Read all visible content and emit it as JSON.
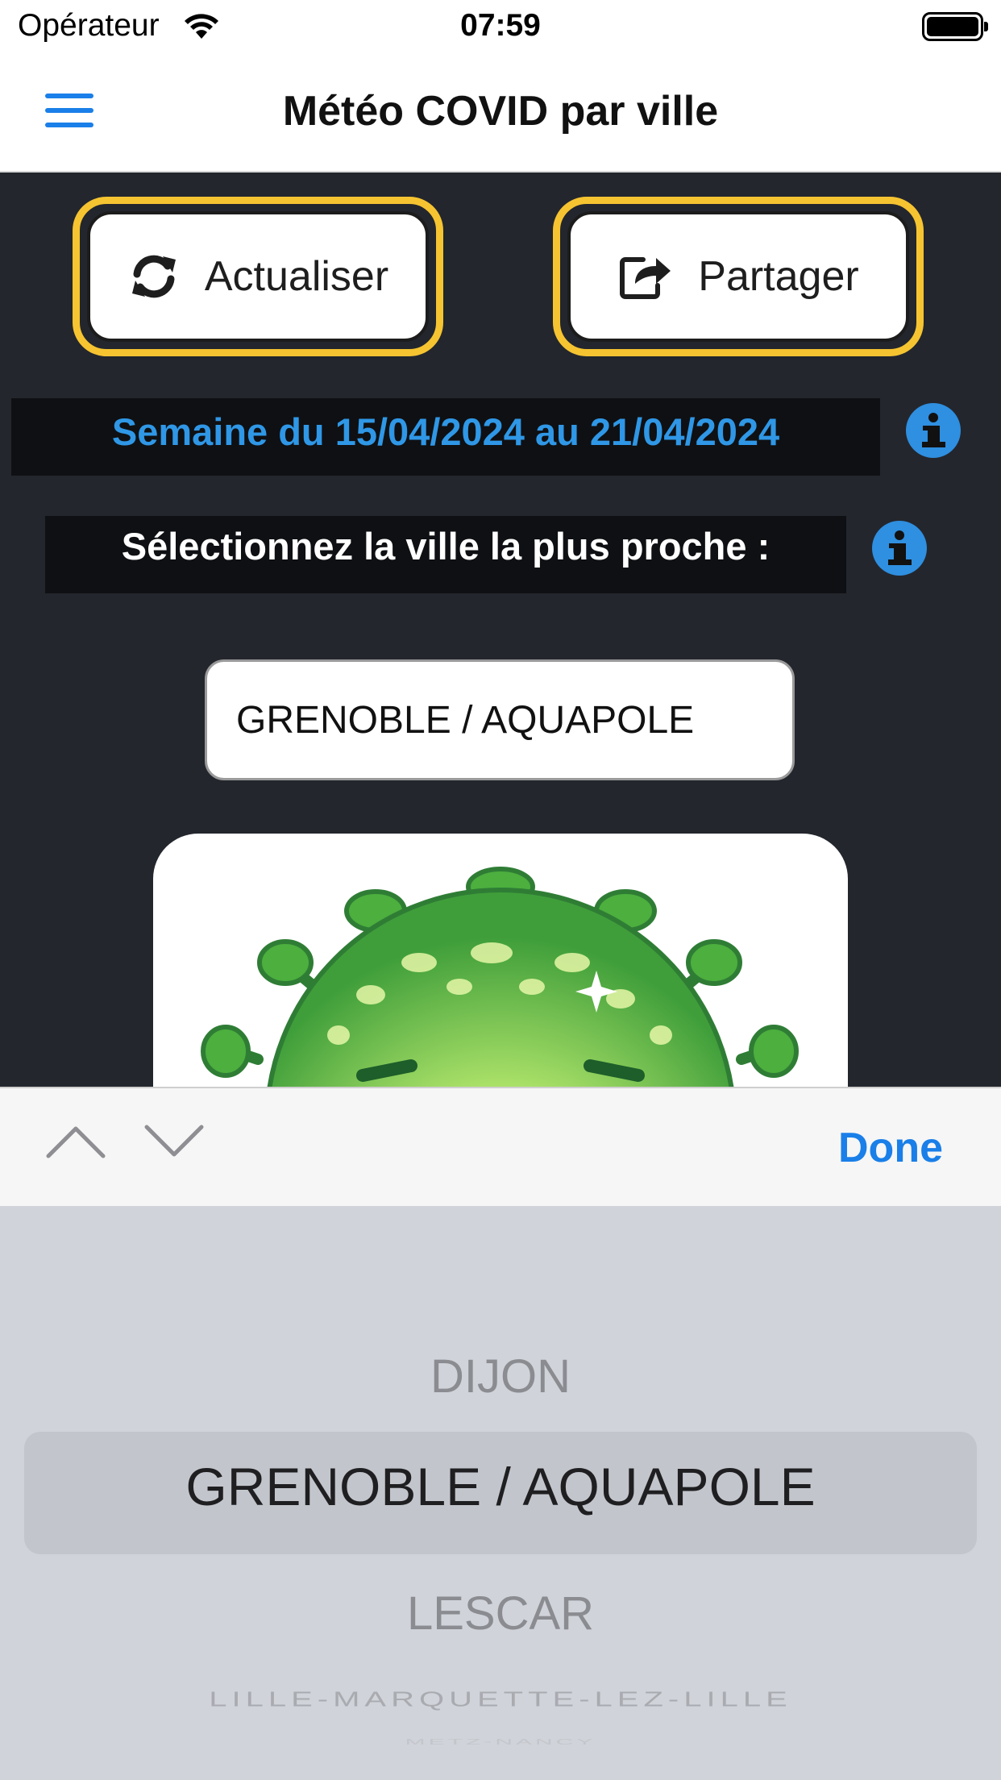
{
  "status_bar": {
    "carrier": "Opérateur",
    "time": "07:59"
  },
  "nav": {
    "title": "Météo COVID par ville"
  },
  "actions": {
    "refresh_label": "Actualiser",
    "share_label": "Partager"
  },
  "week": {
    "text": "Semaine du 15/04/2024 au 21/04/2024"
  },
  "city_select": {
    "prompt": "Sélectionnez la ville la plus proche :",
    "value": "GRENOBLE / AQUAPOLE"
  },
  "accessory": {
    "done_label": "Done"
  },
  "picker": {
    "options": [
      "DIJON",
      "GRENOBLE / AQUAPOLE",
      "LESCAR",
      "LILLE-MARQUETTE-LEZ-LILLE",
      "METZ-NANCY"
    ],
    "selected": "GRENOBLE / AQUAPOLE"
  },
  "colors": {
    "accent": "#1a7fe8",
    "button_border": "#f6c431",
    "content_bg": "#23262d",
    "week_text": "#2f97e6",
    "picker_bg": "#d0d3d9"
  },
  "icons": {
    "menu": "hamburger-icon",
    "refresh": "refresh-icon",
    "share": "share-icon",
    "info": "info-icon",
    "prev": "chevron-up-icon",
    "next": "chevron-down-icon"
  }
}
